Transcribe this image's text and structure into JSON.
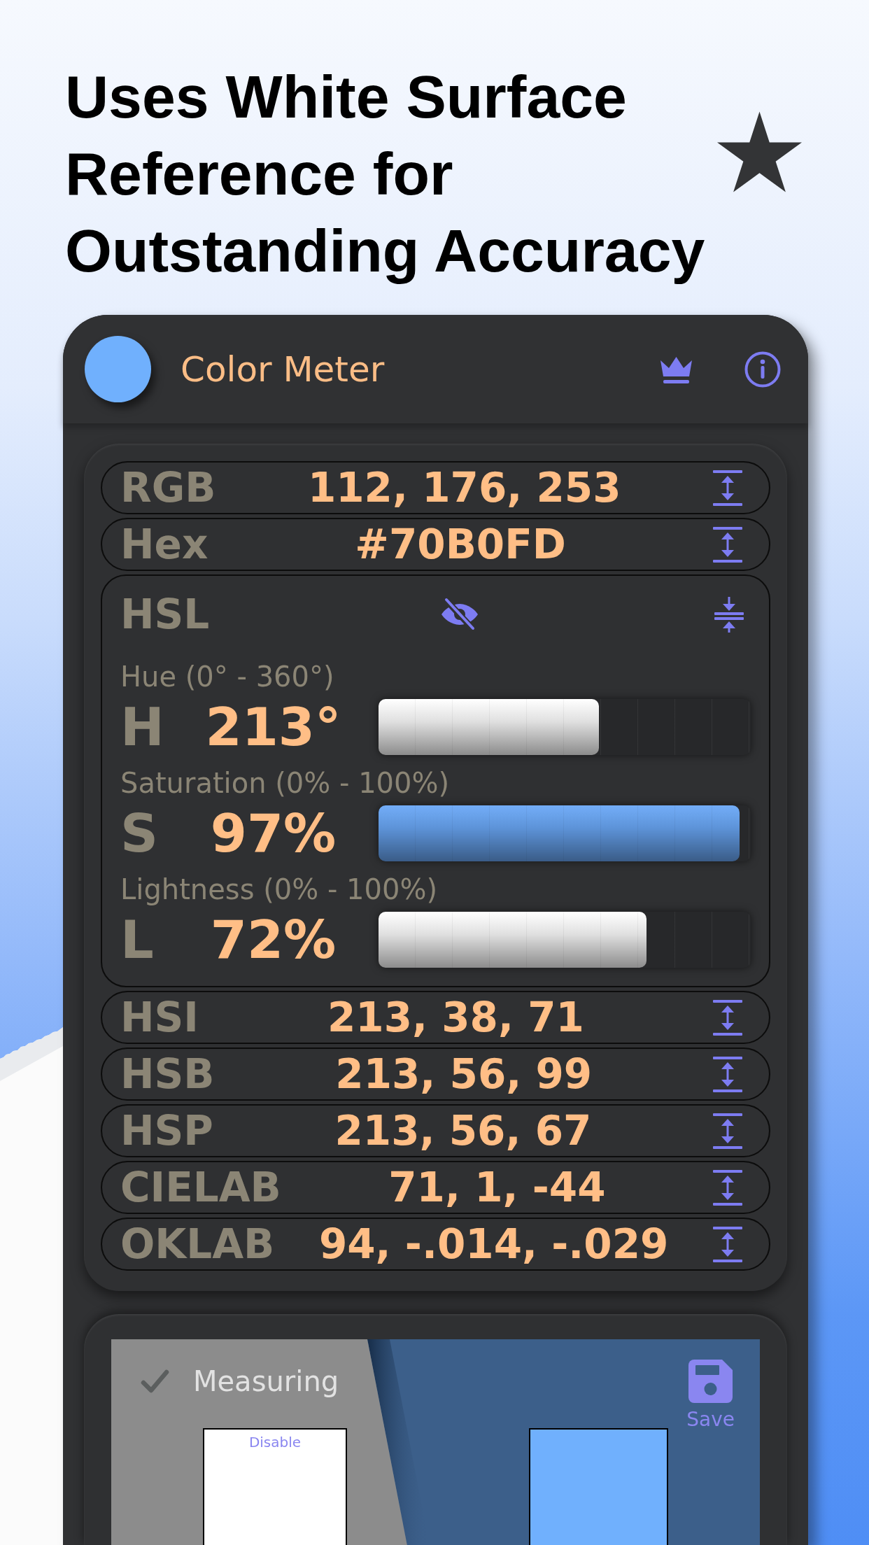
{
  "headline": "Uses White Surface Reference for Outstanding Accuracy",
  "app": {
    "title": "Color Meter",
    "swatch": {
      "color": "#70b0fd"
    }
  },
  "rows": [
    {
      "kind": "value",
      "label": "RGB",
      "value": "112, 176, 253",
      "expanded": false
    },
    {
      "kind": "value",
      "label": "Hex",
      "value": "#70B0FD",
      "expanded": false
    },
    {
      "kind": "sliders",
      "label": "HSL",
      "expanded": true,
      "sliders": [
        {
          "caption": "Hue (0° - 360°)",
          "letter": "H",
          "value": "213°",
          "level": 0.592,
          "color": "#ffffff"
        },
        {
          "caption": "Saturation (0% - 100%)",
          "letter": "S",
          "value": "97%",
          "level": 0.97,
          "color": "#6aa8f7"
        },
        {
          "caption": "Lightness (0% - 100%)",
          "letter": "L",
          "value": "72%",
          "level": 0.72,
          "color": "#ffffff"
        }
      ]
    },
    {
      "kind": "value",
      "label": "HSI",
      "value": "213, 38, 71",
      "expanded": false
    },
    {
      "kind": "value",
      "label": "HSB",
      "value": "213, 56, 99",
      "expanded": false
    },
    {
      "kind": "value",
      "label": "HSP",
      "value": "213, 56, 67",
      "expanded": false
    },
    {
      "kind": "value",
      "label": "CIELAB",
      "value": "71, 1, -44",
      "expanded": false
    },
    {
      "kind": "value",
      "label": "OKLAB",
      "value": "94, -.014, -.029",
      "expanded": false
    }
  ],
  "measure": {
    "status": {
      "label": "Measuring",
      "checked": true
    },
    "reference": {
      "button": "Disable"
    },
    "sample": {
      "color": "#70b0fd"
    },
    "save": {
      "label": "Save"
    }
  }
}
